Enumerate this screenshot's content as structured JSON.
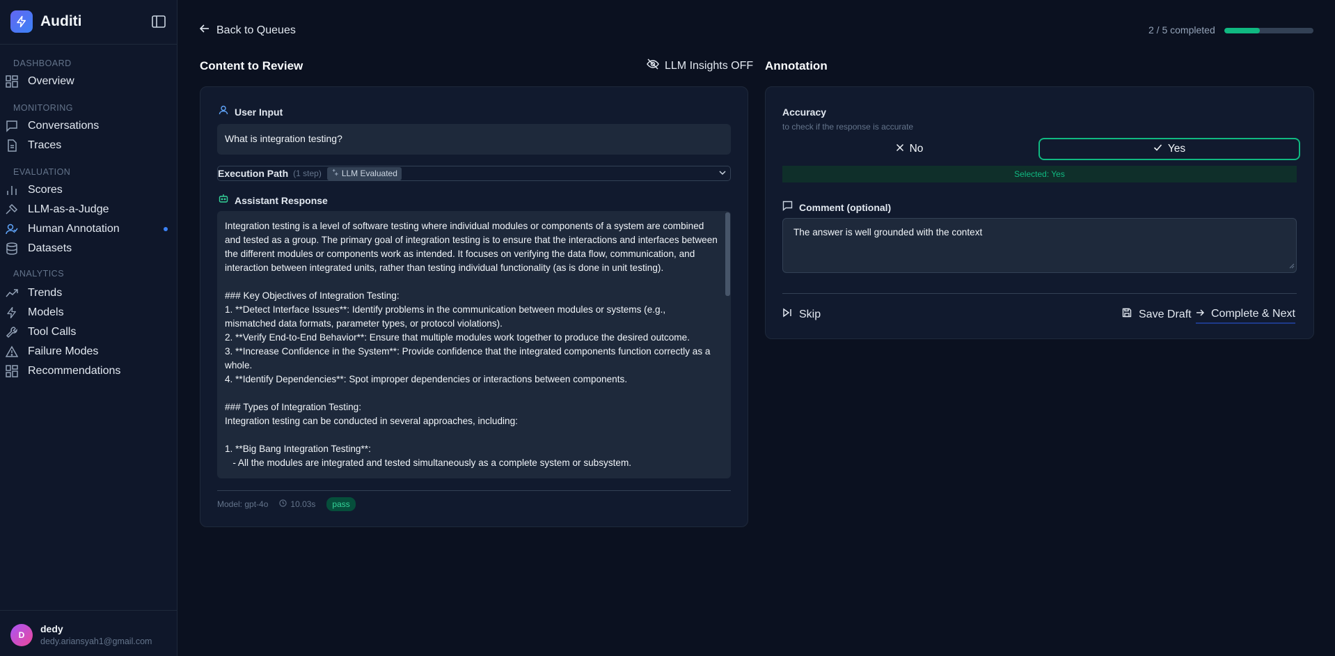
{
  "brand": {
    "name": "Auditi",
    "icon": "bolt-icon"
  },
  "sidebar": {
    "sections": [
      {
        "label": "DASHBOARD",
        "items": [
          {
            "label": "Overview",
            "icon": "grid-icon"
          }
        ]
      },
      {
        "label": "MONITORING",
        "items": [
          {
            "label": "Conversations",
            "icon": "message-icon"
          },
          {
            "label": "Traces",
            "icon": "file-icon"
          }
        ]
      },
      {
        "label": "EVALUATION",
        "items": [
          {
            "label": "Scores",
            "icon": "bar-chart-icon"
          },
          {
            "label": "LLM-as-a-Judge",
            "icon": "gavel-icon"
          },
          {
            "label": "Human Annotation",
            "icon": "user-check-icon",
            "active": true
          },
          {
            "label": "Datasets",
            "icon": "database-icon"
          }
        ]
      },
      {
        "label": "ANALYTICS",
        "items": [
          {
            "label": "Trends",
            "icon": "trend-icon"
          },
          {
            "label": "Models",
            "icon": "bolt-icon"
          },
          {
            "label": "Tool Calls",
            "icon": "wrench-icon"
          },
          {
            "label": "Failure Modes",
            "icon": "warning-icon"
          },
          {
            "label": "Recommendations",
            "icon": "grid-icon"
          }
        ]
      }
    ]
  },
  "user": {
    "initial": "D",
    "name": "dedy",
    "email": "dedy.ariansyah1@gmail.com"
  },
  "header": {
    "back_label": "Back to Queues",
    "progress_text": "2 / 5 completed",
    "progress_fraction": 0.4
  },
  "review": {
    "title": "Content to Review",
    "insights_label": "LLM Insights OFF",
    "user_input_label": "User Input",
    "user_input_value": "What is integration testing?",
    "execution_path_label": "Execution Path",
    "execution_steps": "(1 step)",
    "execution_badge": "LLM Evaluated",
    "assistant_label": "Assistant Response",
    "assistant_response": "Integration testing is a level of software testing where individual modules or components of a system are combined and tested as a group. The primary goal of integration testing is to ensure that the interactions and interfaces between the different modules or components work as intended. It focuses on verifying the data flow, communication, and interaction between integrated units, rather than testing individual functionality (as is done in unit testing).\n\n### Key Objectives of Integration Testing:\n1. **Detect Interface Issues**: Identify problems in the communication between modules or systems (e.g., mismatched data formats, parameter types, or protocol violations).\n2. **Verify End-to-End Behavior**: Ensure that multiple modules work together to produce the desired outcome.\n3. **Increase Confidence in the System**: Provide confidence that the integrated components function correctly as a whole.\n4. **Identify Dependencies**: Spot improper dependencies or interactions between components.\n\n### Types of Integration Testing:\nIntegration testing can be conducted in several approaches, including:\n\n1. **Big Bang Integration Testing**:\n   - All the modules are integrated and tested simultaneously as a complete system or subsystem.",
    "model": "Model: gpt-4o",
    "latency": "10.03s",
    "status": "pass"
  },
  "annotation": {
    "title": "Annotation",
    "field_label": "Accuracy",
    "field_help": "to check if the response is accurate",
    "option_no": "No",
    "option_yes": "Yes",
    "selected_text": "Selected: Yes",
    "comment_label": "Comment (optional)",
    "comment_value": "The answer is well grounded with the context",
    "skip_label": "Skip",
    "save_label": "Save Draft",
    "next_label": "Complete & Next"
  },
  "colors": {
    "accent": "#10b981",
    "brand": "#6366f1",
    "background": "#0b1120",
    "panel": "#111a2e"
  }
}
